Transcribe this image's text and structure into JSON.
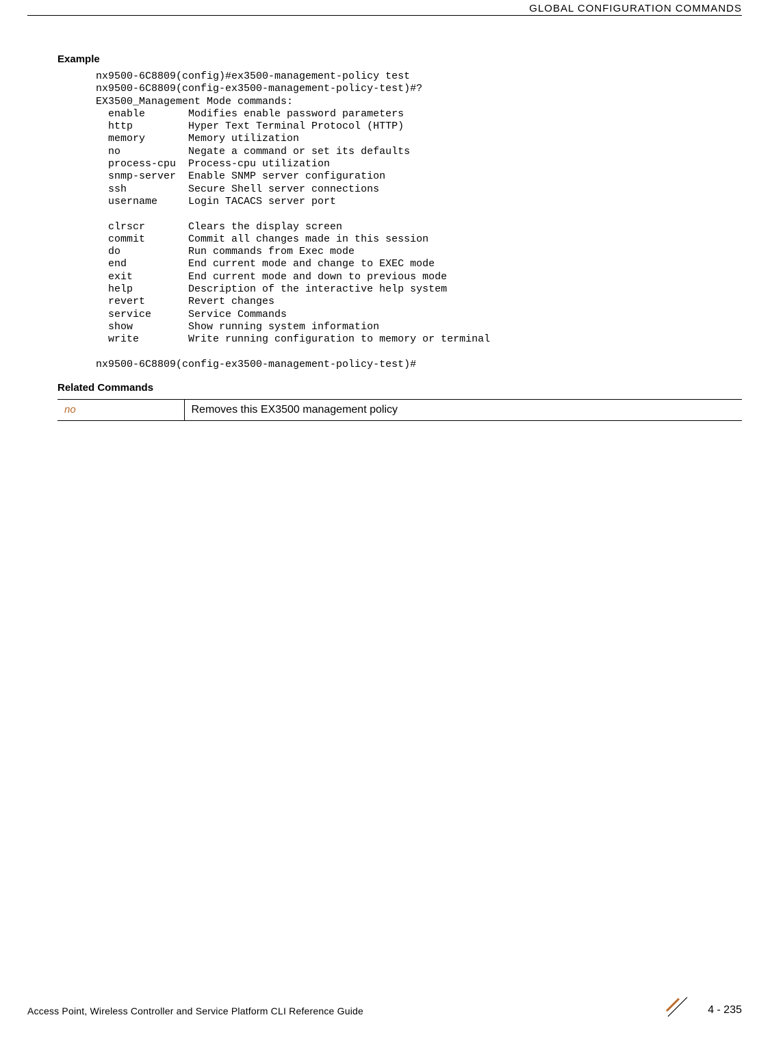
{
  "header": "GLOBAL CONFIGURATION COMMANDS",
  "example_heading": "Example",
  "code_line_1": "nx9500-6C8809(config)#ex3500-management-policy test",
  "code_line_2": "nx9500-6C8809(config-ex3500-management-policy-test)#?",
  "code_line_3": "EX3500_Management Mode commands:",
  "cmd_enable": "  enable       Modifies enable password parameters",
  "cmd_http": "  http         Hyper Text Terminal Protocol (HTTP)",
  "cmd_memory": "  memory       Memory utilization",
  "cmd_no": "  no           Negate a command or set its defaults",
  "cmd_process": "  process-cpu  Process-cpu utilization",
  "cmd_snmp": "  snmp-server  Enable SNMP server configuration",
  "cmd_ssh": "  ssh          Secure Shell server connections",
  "cmd_username": "  username     Login TACACS server port",
  "cmd_blank1": "",
  "cmd_clrscr": "  clrscr       Clears the display screen",
  "cmd_commit": "  commit       Commit all changes made in this session",
  "cmd_do": "  do           Run commands from Exec mode",
  "cmd_end": "  end          End current mode and change to EXEC mode",
  "cmd_exit": "  exit         End current mode and down to previous mode",
  "cmd_help": "  help         Description of the interactive help system",
  "cmd_revert": "  revert       Revert changes",
  "cmd_service": "  service      Service Commands",
  "cmd_show": "  show         Show running system information",
  "cmd_write": "  write        Write running configuration to memory or terminal",
  "cmd_blank2": "",
  "code_line_end": "nx9500-6C8809(config-ex3500-management-policy-test)#",
  "related_heading": "Related Commands",
  "related_link": "no",
  "related_desc": "Removes this EX3500 management policy",
  "footer_text": "Access Point, Wireless Controller and Service Platform CLI Reference Guide",
  "page_number": "4 - 235"
}
